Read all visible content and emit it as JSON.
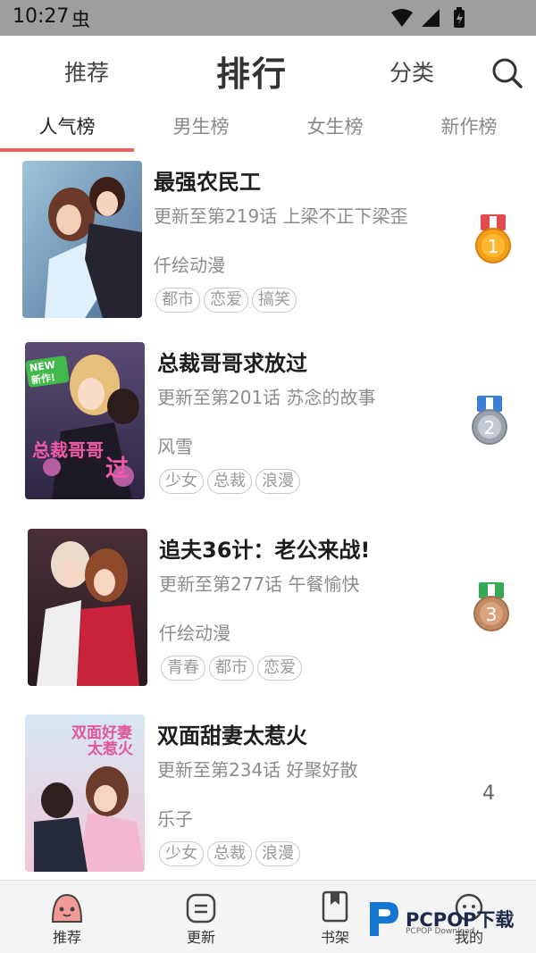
{
  "status_bar": {
    "time": "10:27",
    "bug_glyph": "虫"
  },
  "top_nav": {
    "recommend": "推荐",
    "ranking": "排行",
    "category": "分类",
    "search_icon": "search-icon"
  },
  "sub_tabs": [
    "人气榜",
    "男生榜",
    "女生榜",
    "新作榜"
  ],
  "colors": {
    "accent": "#e8655f",
    "gold": "#f0a21b",
    "silver": "#9aa3ad",
    "bronze": "#c28a62"
  },
  "list": [
    {
      "title": "最强农民工",
      "update": "更新至第219话 上梁不正下梁歪",
      "author": "仟绘动漫",
      "tags": [
        "都市",
        "恋爱",
        "搞笑"
      ],
      "rank": "1",
      "cover_badge": ""
    },
    {
      "title": "总裁哥哥求放过",
      "update": "更新至第201话 苏念的故事",
      "author": "风雪",
      "tags": [
        "少女",
        "总裁",
        "浪漫"
      ],
      "rank": "2",
      "cover_badge": "NEW 新作!"
    },
    {
      "title": "追夫36计：老公来战!",
      "update": "更新至第277话 午餐愉快",
      "author": "仟绘动漫",
      "tags": [
        "青春",
        "都市",
        "恋爱"
      ],
      "rank": "3",
      "cover_badge": ""
    },
    {
      "title": "双面甜妻太惹火",
      "update": "更新至第234话 好聚好散",
      "author": "乐子",
      "tags": [
        "少女",
        "总裁",
        "浪漫"
      ],
      "rank": "4",
      "cover_badge": ""
    }
  ],
  "bottom_nav": [
    {
      "label": "推荐",
      "icon": "recommend-icon"
    },
    {
      "label": "更新",
      "icon": "update-icon"
    },
    {
      "label": "书架",
      "icon": "bookshelf-icon"
    },
    {
      "label": "我的",
      "icon": "profile-icon"
    }
  ],
  "watermark": {
    "text": "PCPOP下载",
    "sub": "PCPOP Download"
  }
}
